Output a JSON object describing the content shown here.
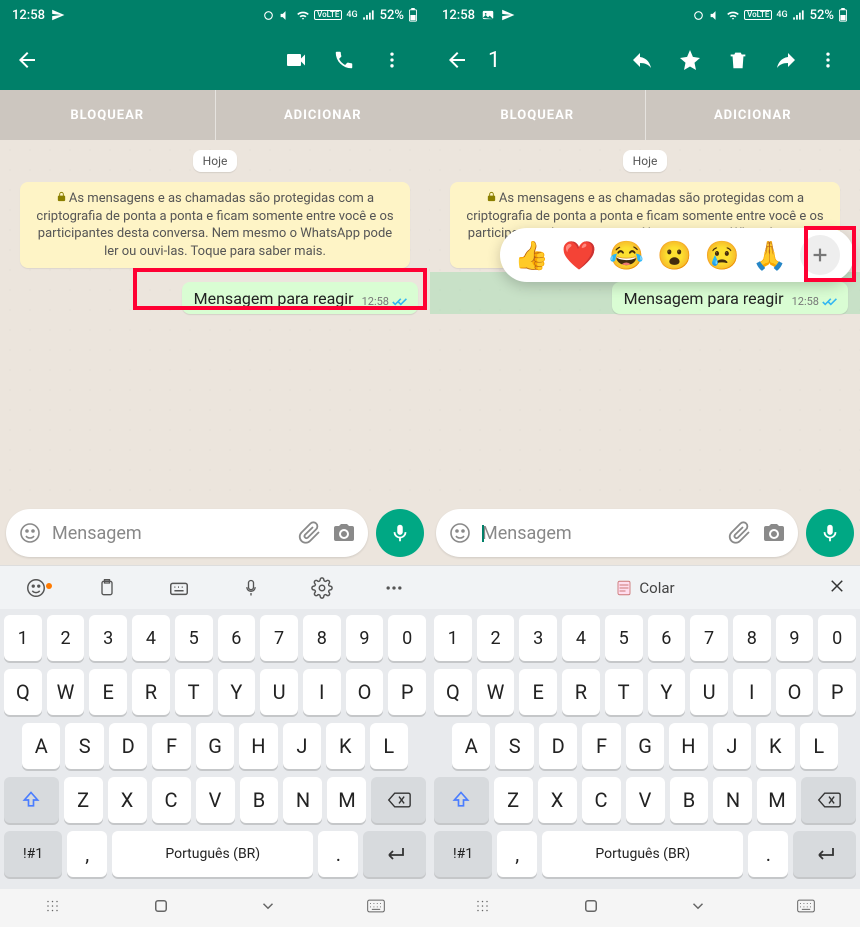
{
  "statusbar": {
    "time": "12:58",
    "battery": "52%"
  },
  "appbar_left": {
    "selection_count": ""
  },
  "appbar_right": {
    "selection_count": "1"
  },
  "block_bar": {
    "block": "BLOQUEAR",
    "add": "ADICIONAR"
  },
  "chat": {
    "date_label": "Hoje",
    "encryption_notice": "As mensagens e as chamadas são protegidas com a criptografia de ponta a ponta e ficam somente entre você e os participantes desta conversa. Nem mesmo o WhatsApp pode ler ou ouvi-las. Toque para saber mais.",
    "message_text": "Mensagem para reagir",
    "message_time": "12:58"
  },
  "reactions": {
    "emojis": [
      "👍",
      "❤️",
      "😂",
      "😮",
      "😢",
      "🙏"
    ],
    "plus": "+"
  },
  "input": {
    "placeholder": "Mensagem"
  },
  "keyboard": {
    "paste_label": "Colar",
    "row_nums": [
      "1",
      "2",
      "3",
      "4",
      "5",
      "6",
      "7",
      "8",
      "9",
      "0"
    ],
    "row1": [
      "Q",
      "W",
      "E",
      "R",
      "T",
      "Y",
      "U",
      "I",
      "O",
      "P"
    ],
    "row2": [
      "A",
      "S",
      "D",
      "F",
      "G",
      "H",
      "J",
      "K",
      "L"
    ],
    "row3": [
      "Z",
      "X",
      "C",
      "V",
      "B",
      "N",
      "M"
    ],
    "symbol_key": "!#1",
    "comma_key": ",",
    "space_label": "Português (BR)",
    "period_key": "."
  }
}
